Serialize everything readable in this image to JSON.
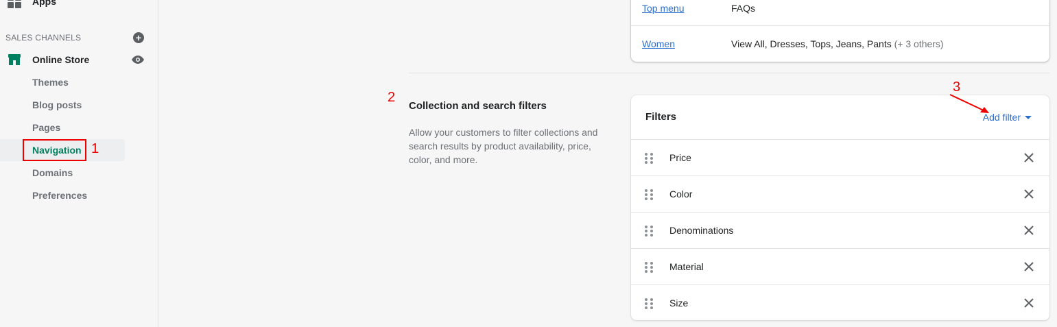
{
  "sidebar": {
    "apps_label": "Apps",
    "sales_channels_title": "SALES CHANNELS",
    "online_store_label": "Online Store",
    "sub_items": [
      "Themes",
      "Blog posts",
      "Pages",
      "Navigation",
      "Domains",
      "Preferences"
    ],
    "active_item": "Navigation"
  },
  "menus": {
    "rows": [
      {
        "name": "Top menu",
        "items": "FAQs",
        "extra": ""
      },
      {
        "name": "Women",
        "items": "View All, Dresses, Tops, Jeans, Pants",
        "extra": "(+ 3 others)"
      }
    ]
  },
  "section": {
    "title": "Collection and search filters",
    "description": "Allow your customers to filter collections and search results by product availability, price, color, and more."
  },
  "filters": {
    "title": "Filters",
    "add_label": "Add filter",
    "items": [
      "Price",
      "Color",
      "Denominations",
      "Material",
      "Size"
    ]
  },
  "annotations": {
    "step1": "1",
    "step2": "2",
    "step3": "3",
    "color": "#e00000"
  },
  "colors": {
    "accent_green": "#008060",
    "link_blue": "#2c6ecb",
    "background": "#f6f6f7"
  },
  "icons": {
    "apps": "apps-grid-icon",
    "add_channel": "plus-circle-icon",
    "store": "store-icon",
    "view": "eye-icon",
    "drag": "drag-handle-icon",
    "remove": "close-icon",
    "dropdown": "caret-down-icon"
  }
}
